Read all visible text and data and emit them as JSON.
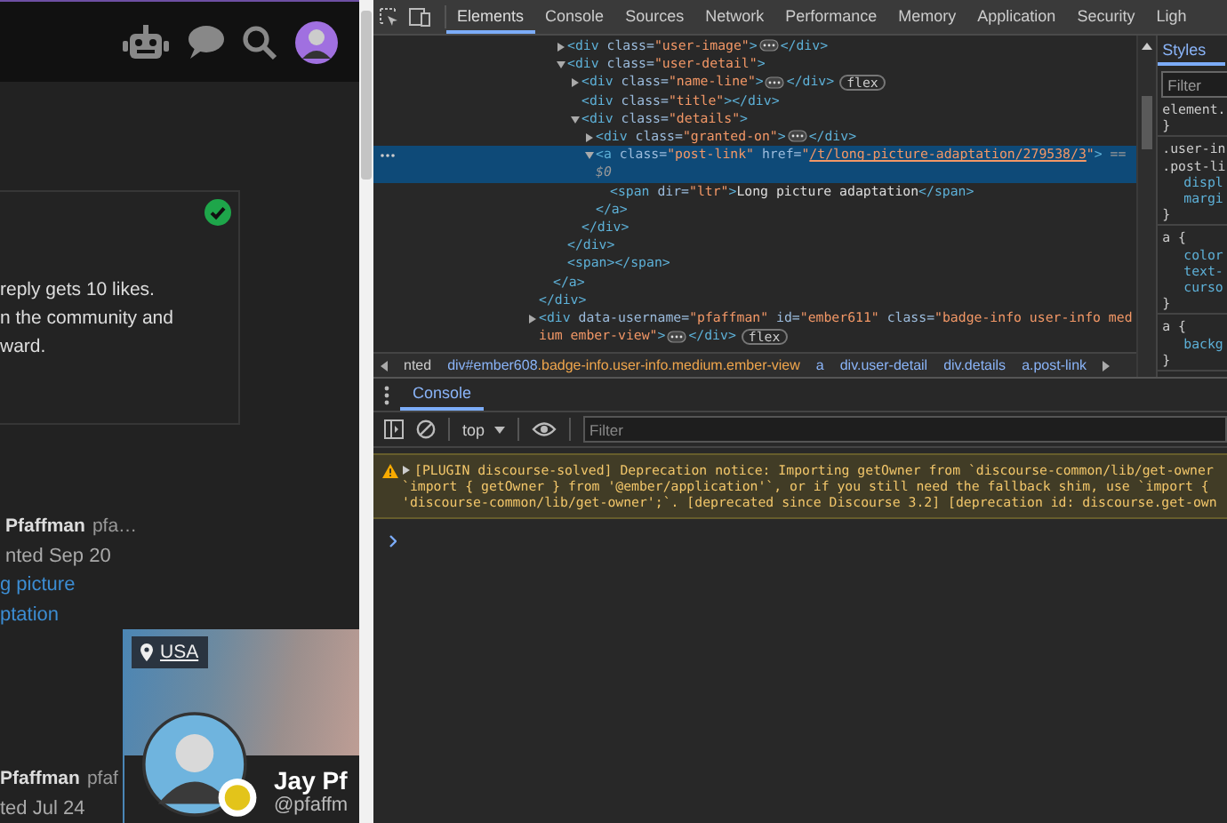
{
  "forum": {
    "notice": {
      "lines": [
        "reply gets 10 likes.",
        "n the community and",
        "ward."
      ]
    },
    "posts": [
      {
        "name": "Pfaffman",
        "username": "pfa…",
        "date": "nted Sep 20",
        "link_lines": [
          "g picture",
          "ptation"
        ]
      },
      {
        "name": "Pfaffman",
        "username": "pfaf",
        "date": "ted Jul 24"
      }
    ],
    "user_card": {
      "location": "USA",
      "name": "Jay Pf",
      "username": "@pfaffm"
    }
  },
  "devtools": {
    "tabs": [
      {
        "label": "Elements",
        "selected": true
      },
      {
        "label": "Console",
        "selected": false
      },
      {
        "label": "Sources",
        "selected": false
      },
      {
        "label": "Network",
        "selected": false
      },
      {
        "label": "Performance",
        "selected": false
      },
      {
        "label": "Memory",
        "selected": false
      },
      {
        "label": "Application",
        "selected": false
      },
      {
        "label": "Security",
        "selected": false
      },
      {
        "label": "Ligh",
        "selected": false
      }
    ],
    "dom_tree": [
      {
        "close": [
          {
            "kind": "tag",
            "text": "</div>"
          }
        ],
        "children": [
          {
            "close": [
              {
                "kind": "tag",
                "text": "</a>"
              }
            ],
            "children": [
              {
                "selected": false,
                "expanded": false,
                "line": [
                  {
                    "kind": "tag",
                    "text": "<div"
                  },
                  {
                    "kind": "attr",
                    "text": " class="
                  },
                  {
                    "kind": "value",
                    "text": "\"user-image\""
                  },
                  {
                    "kind": "tag",
                    "text": ">"
                  },
                  {
                    "kind": "dots"
                  },
                  {
                    "kind": "tag",
                    "text": "</div>"
                  }
                ]
              },
              {
                "selected": false,
                "expanded": true,
                "line": [
                  {
                    "kind": "tag",
                    "text": "<div"
                  },
                  {
                    "kind": "attr",
                    "text": " class="
                  },
                  {
                    "kind": "value",
                    "text": "\"user-detail\""
                  },
                  {
                    "kind": "tag",
                    "text": ">"
                  }
                ],
                "children": [
                  {
                    "selected": false,
                    "expanded": false,
                    "line": [
                      {
                        "kind": "tag",
                        "text": "<div"
                      },
                      {
                        "kind": "attr",
                        "text": " class="
                      },
                      {
                        "kind": "value",
                        "text": "\"name-line\""
                      },
                      {
                        "kind": "tag",
                        "text": ">"
                      },
                      {
                        "kind": "dots"
                      },
                      {
                        "kind": "tag",
                        "text": "</div>"
                      },
                      {
                        "kind": "badge",
                        "text": "flex"
                      }
                    ]
                  },
                  {
                    "selected": false,
                    "line": [
                      {
                        "kind": "tag",
                        "text": "<div"
                      },
                      {
                        "kind": "attr",
                        "text": " class="
                      },
                      {
                        "kind": "value",
                        "text": "\"title\""
                      },
                      {
                        "kind": "tag",
                        "text": "></div>"
                      }
                    ]
                  },
                  {
                    "selected": false,
                    "expanded": true,
                    "line": [
                      {
                        "kind": "tag",
                        "text": "<div"
                      },
                      {
                        "kind": "attr",
                        "text": " class="
                      },
                      {
                        "kind": "value",
                        "text": "\"details\""
                      },
                      {
                        "kind": "tag",
                        "text": ">"
                      }
                    ],
                    "children": [
                      {
                        "selected": false,
                        "expanded": false,
                        "line": [
                          {
                            "kind": "tag",
                            "text": "<div"
                          },
                          {
                            "kind": "attr",
                            "text": " class="
                          },
                          {
                            "kind": "value",
                            "text": "\"granted-on\""
                          },
                          {
                            "kind": "tag",
                            "text": ">"
                          },
                          {
                            "kind": "dots"
                          },
                          {
                            "kind": "tag",
                            "text": "</div>"
                          }
                        ]
                      },
                      {
                        "selected": true,
                        "expanded": true,
                        "line": [
                          {
                            "kind": "tag",
                            "text": "<a"
                          },
                          {
                            "kind": "attr",
                            "text": " class="
                          },
                          {
                            "kind": "value",
                            "text": "\"post-link\""
                          },
                          {
                            "kind": "attr",
                            "text": " href="
                          },
                          {
                            "kind": "value",
                            "text": "\""
                          },
                          {
                            "kind": "link",
                            "text": "/t/long-picture-adaptation/279538/3"
                          },
                          {
                            "kind": "value",
                            "text": "\""
                          },
                          {
                            "kind": "tag",
                            "text": ">"
                          },
                          {
                            "kind": "hint",
                            "text": " == $0"
                          }
                        ],
                        "children": [
                          {
                            "selected": false,
                            "line": [
                              {
                                "kind": "tag",
                                "text": "<span"
                              },
                              {
                                "kind": "attr",
                                "text": " dir="
                              },
                              {
                                "kind": "value",
                                "text": "\"ltr\""
                              },
                              {
                                "kind": "tag",
                                "text": ">"
                              },
                              {
                                "kind": "text",
                                "text": "Long picture adaptation"
                              },
                              {
                                "kind": "tag",
                                "text": "</span>"
                              }
                            ]
                          }
                        ],
                        "close": [
                          {
                            "kind": "tag",
                            "text": "</a>"
                          }
                        ]
                      }
                    ],
                    "close": [
                      {
                        "kind": "tag",
                        "text": "</div>"
                      }
                    ]
                  }
                ],
                "close": [
                  {
                    "kind": "tag",
                    "text": "</div>"
                  }
                ]
              },
              {
                "selected": false,
                "line": [
                  {
                    "kind": "tag",
                    "text": "<span></span>"
                  }
                ]
              }
            ]
          }
        ]
      },
      {
        "selected": false,
        "expanded": false,
        "line": [
          {
            "kind": "tag",
            "text": "<div"
          },
          {
            "kind": "attr",
            "text": " data-username="
          },
          {
            "kind": "value",
            "text": "\"pfaffman\""
          },
          {
            "kind": "attr",
            "text": " id="
          },
          {
            "kind": "value",
            "text": "\"ember611\""
          },
          {
            "kind": "attr",
            "text": " class="
          },
          {
            "kind": "value",
            "text": "\"badge-info user-info med"
          },
          {
            "kind": "break"
          },
          {
            "kind": "value",
            "text": "ium ember-view\""
          },
          {
            "kind": "tag",
            "text": ">"
          },
          {
            "kind": "dots"
          },
          {
            "kind": "tag",
            "text": "</div>"
          },
          {
            "kind": "badge",
            "text": "flex"
          }
        ]
      }
    ],
    "breadcrumbs": [
      {
        "text": "nted"
      },
      {
        "text": "div#ember608",
        "classes": ".badge-info.user-info.medium.ember-view"
      },
      {
        "text": "a"
      },
      {
        "text": "div.user-detail"
      },
      {
        "text": "div.details"
      },
      {
        "text": "a.post-link"
      }
    ],
    "styles": {
      "tab": "Styles",
      "filter_placeholder": "Filter",
      "rules": [
        {
          "lines": [
            {
              "kind": "selector",
              "text": "element."
            },
            {
              "kind": "brace",
              "text": "}"
            }
          ]
        },
        {
          "lines": [
            {
              "kind": "selector",
              "text": ".user-in"
            },
            {
              "kind": "selector",
              "text": ".post-li"
            },
            {
              "kind": "property",
              "text": "displ"
            },
            {
              "kind": "property",
              "text": "margi"
            },
            {
              "kind": "brace",
              "text": "}"
            }
          ]
        },
        {
          "lines": [
            {
              "kind": "selector",
              "text": "a {"
            },
            {
              "kind": "property",
              "text": "color"
            },
            {
              "kind": "property",
              "text": "text-"
            },
            {
              "kind": "property",
              "text": "curso"
            },
            {
              "kind": "brace",
              "text": "}"
            }
          ]
        },
        {
          "lines": [
            {
              "kind": "selector",
              "text": "a {"
            },
            {
              "kind": "property",
              "text": "backg"
            },
            {
              "kind": "brace",
              "text": "}"
            }
          ]
        }
      ]
    },
    "drawer": {
      "tab": "Console",
      "context": "top",
      "filter_placeholder": "Filter",
      "messages": [
        {
          "kind": "warning",
          "expanded": false,
          "lines": [
            "[PLUGIN discourse-solved] Deprecation notice: Importing getOwner from `discourse-common/lib/get-owner",
            "`import { getOwner } from '@ember/application'`, or if you still need the fallback shim, use `import {",
            "'discourse-common/lib/get-owner';`. [deprecated since Discourse 3.2] [deprecation id: discourse.get-own"
          ]
        }
      ]
    }
  }
}
